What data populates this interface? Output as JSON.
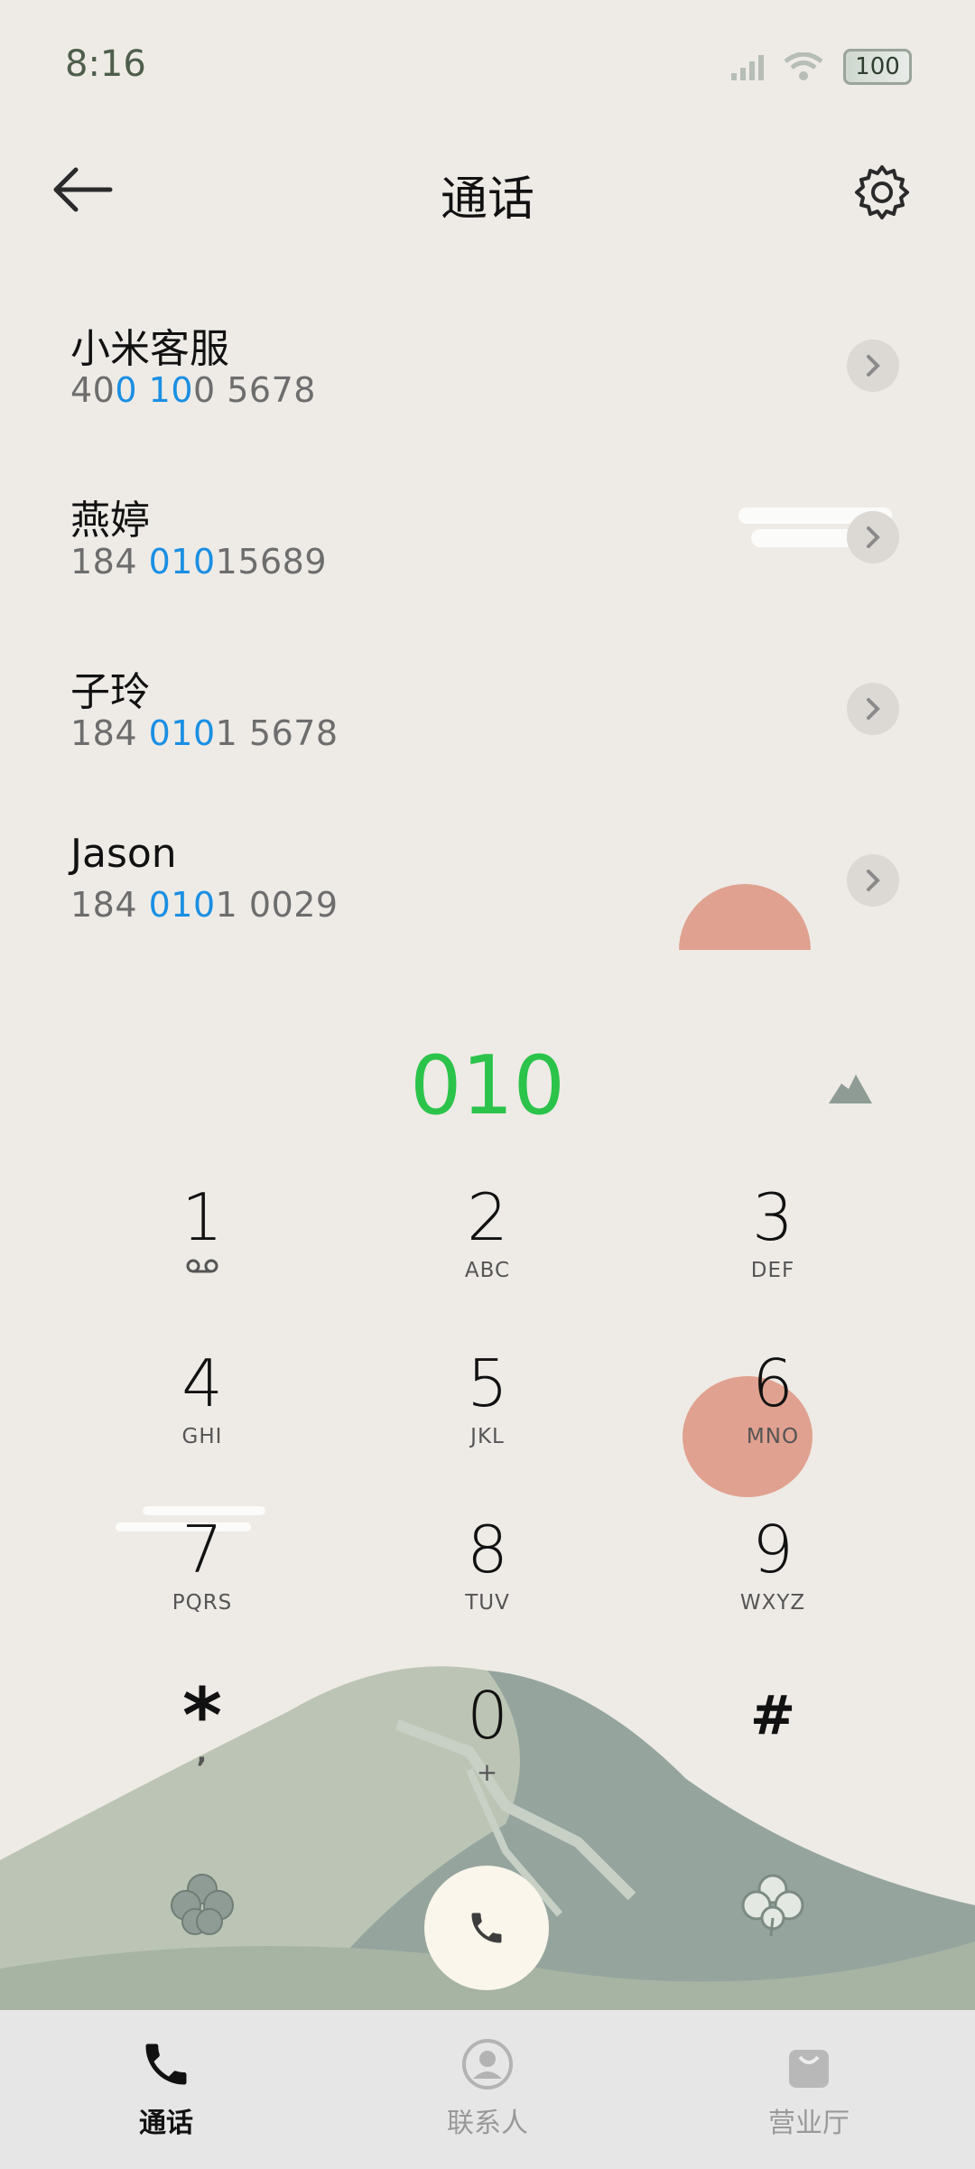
{
  "status": {
    "time": "8:16",
    "battery": "100"
  },
  "header": {
    "title": "通话"
  },
  "contacts": [
    {
      "name": "小米客服",
      "num_pre": "40",
      "num_hl1": "0",
      "num_mid": " ",
      "num_hl2": "10",
      "num_post": "0 5678"
    },
    {
      "name": "燕婷",
      "num_pre": "184 ",
      "num_hl1": "010",
      "num_mid": "",
      "num_hl2": "",
      "num_post": "15689"
    },
    {
      "name": "子玲",
      "num_pre": "184 ",
      "num_hl1": "010",
      "num_mid": "",
      "num_hl2": "",
      "num_post": "1 5678"
    },
    {
      "name": "Jason",
      "num_pre": "184 ",
      "num_hl1": "010",
      "num_mid": "",
      "num_hl2": "",
      "num_post": "1 0029"
    }
  ],
  "dialer": {
    "typed": "010"
  },
  "keys": [
    {
      "digit": "1",
      "letters": ""
    },
    {
      "digit": "2",
      "letters": "ABC"
    },
    {
      "digit": "3",
      "letters": "DEF"
    },
    {
      "digit": "4",
      "letters": "GHI"
    },
    {
      "digit": "5",
      "letters": "JKL"
    },
    {
      "digit": "6",
      "letters": "MNO"
    },
    {
      "digit": "7",
      "letters": "PQRS"
    },
    {
      "digit": "8",
      "letters": "TUV"
    },
    {
      "digit": "9",
      "letters": "WXYZ"
    },
    {
      "digit": "*",
      "letters": ","
    },
    {
      "digit": "0",
      "letters": "+"
    },
    {
      "digit": "#",
      "letters": ""
    }
  ],
  "nav": [
    {
      "label": "通话",
      "active": true
    },
    {
      "label": "联系人",
      "active": false
    },
    {
      "label": "营业厅",
      "active": false
    }
  ],
  "colors": {
    "background": "#eeebe6",
    "highlight": "#1a8fe3",
    "typed_number": "#2bc34a",
    "sun": "#e1a190",
    "mountain": "#95a59e"
  },
  "icons": [
    "back-arrow-icon",
    "gear-icon",
    "chevron-right-icon",
    "voicemail-icon",
    "clover-icon",
    "phone-icon",
    "contact-icon",
    "shop-bag-icon",
    "mountain-icon",
    "cloud-icon"
  ]
}
